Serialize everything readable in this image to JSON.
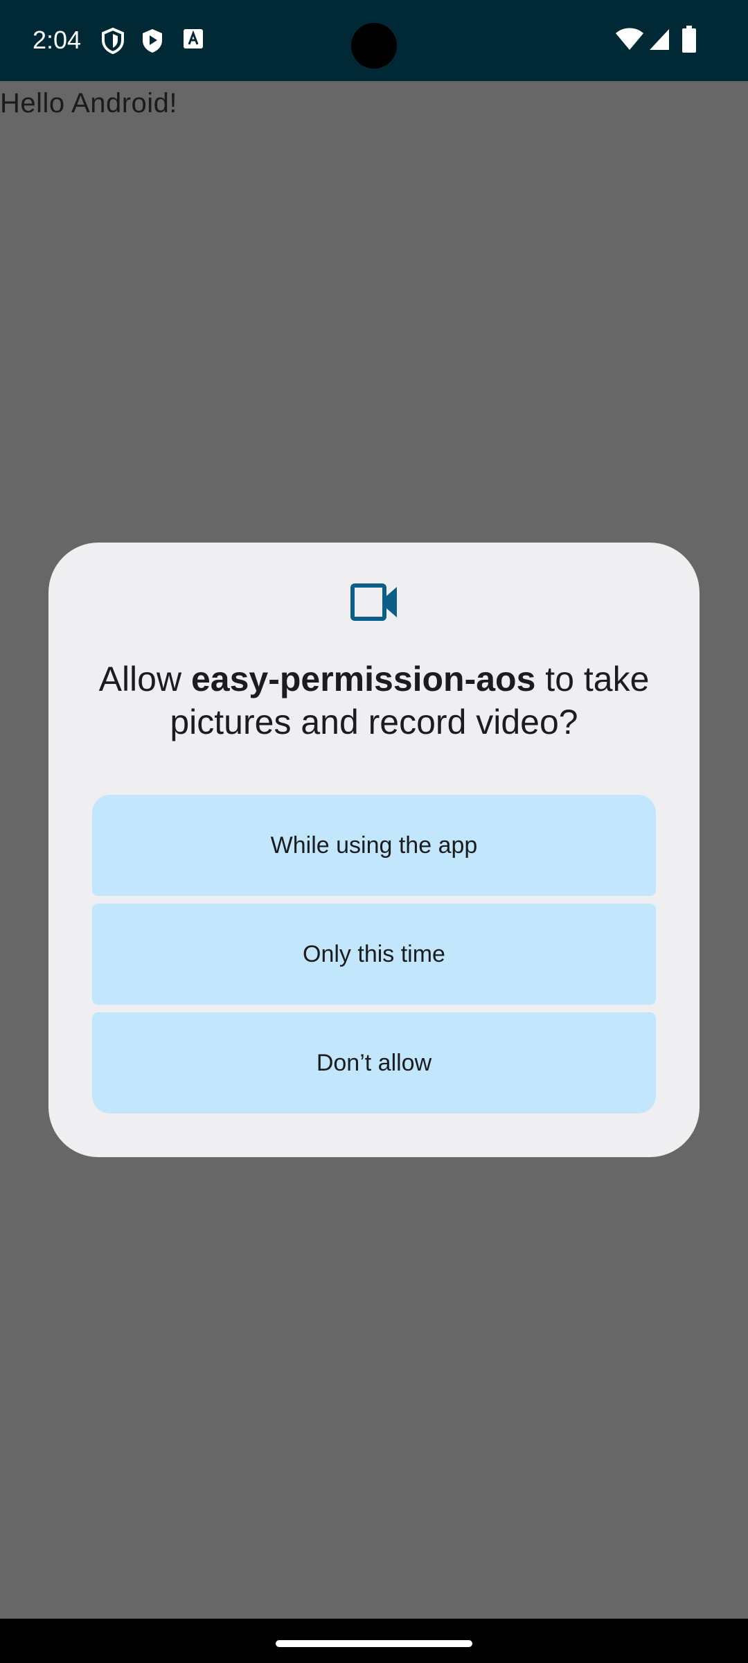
{
  "status_bar": {
    "time": "2:04",
    "icons": [
      "shield-icon",
      "play-shield-icon",
      "font-a-icon",
      "wifi-icon",
      "cellular-signal-icon",
      "battery-icon"
    ],
    "background": "#002835"
  },
  "app": {
    "text": "Hello Android!"
  },
  "dialog": {
    "icon": "video-camera-icon",
    "icon_color": "#0b5f86",
    "title_prefix": "Allow ",
    "app_name": "easy-permission-aos",
    "title_suffix": " to take pictures and record video?",
    "buttons": [
      {
        "label": "While using the app"
      },
      {
        "label": "Only this time"
      },
      {
        "label": "Don’t allow"
      }
    ],
    "button_color": "#c2e6fb",
    "background": "#efeff2"
  },
  "scrim_color": "#676767"
}
